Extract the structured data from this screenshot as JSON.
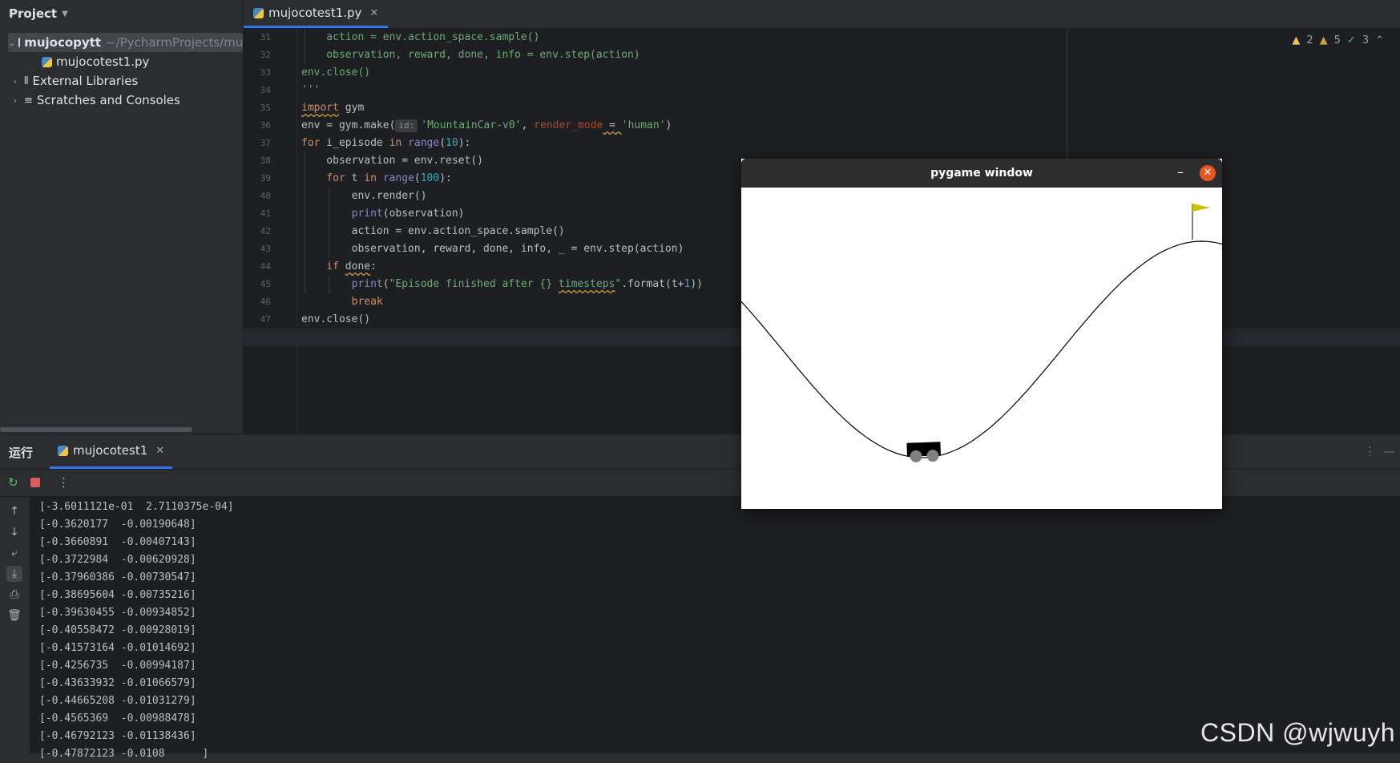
{
  "sidebar": {
    "title": "Project",
    "project_name": "mujocopytt",
    "project_path": "~/PycharmProjects/mu",
    "file": "mujocotest1.py",
    "external_libraries": "External Libraries",
    "scratches": "Scratches and Consoles"
  },
  "editor": {
    "tab_label": "mujocotest1.py",
    "inspections": {
      "warnings": "2",
      "weak_warnings": "5",
      "ok": "3"
    },
    "line_numbers": [
      "31",
      "32",
      "33",
      "34",
      "35",
      "36",
      "37",
      "38",
      "39",
      "40",
      "41",
      "42",
      "43",
      "44",
      "45",
      "46",
      "47",
      "48"
    ],
    "lines": {
      "l31": "    action = env.action_space.sample()",
      "l32": "    observation, reward, done, info = env.step(action)",
      "l33": "env.close()",
      "l34": "'''",
      "l35_kw": "import",
      "l35_rest": " gym",
      "l36_a": "env = gym.make(",
      "l36_hint": "id:",
      "l36_str": "'MountainCar-v0'",
      "l36_b": ", ",
      "l36_param": "render_mode",
      "l36_c": " = ",
      "l36_str2": "'human'",
      "l36_d": ")",
      "l37_kw": "for",
      "l37_a": " i_episode ",
      "l37_kw2": "in",
      "l37_b": " ",
      "l37_fn": "range",
      "l37_c": "(",
      "l37_num": "10",
      "l37_d": "):",
      "l38": "    observation = env.reset()",
      "l39_pre": "    ",
      "l39_kw": "for",
      "l39_a": " t ",
      "l39_kw2": "in",
      "l39_b": " ",
      "l39_fn": "range",
      "l39_c": "(",
      "l39_num": "100",
      "l39_d": "):",
      "l40": "        env.render()",
      "l41_pre": "        ",
      "l41_fn": "print",
      "l41_rest": "(observation)",
      "l42": "        action = env.action_space.sample()",
      "l43": "        observation, reward, done, info, _ = env.step(action)",
      "l44_pre": "    ",
      "l44_kw": "if",
      "l44_b": " ",
      "l44_warn": "done",
      "l44_c": ":",
      "l45_pre": "        ",
      "l45_fn": "print",
      "l45_a": "(",
      "l45_str1": "\"Episode finished after {} ",
      "l45_warn": "timesteps",
      "l45_str2": "\"",
      "l45_b": ".format(t+",
      "l45_num": "1",
      "l45_c": "))",
      "l46_pre": "        ",
      "l46_kw": "break",
      "l47": "env.close()",
      "l48": ""
    }
  },
  "run_panel": {
    "title": "运行",
    "tab_label": "mujocotest1",
    "output": [
      "[-3.6011121e-01  2.7110375e-04]",
      "[-0.3620177  -0.00190648]",
      "[-0.3660891  -0.00407143]",
      "[-0.3722984  -0.00620928]",
      "[-0.37960386 -0.00730547]",
      "[-0.38695604 -0.00735216]",
      "[-0.39630455 -0.00934852]",
      "[-0.40558472 -0.00928019]",
      "[-0.41573164 -0.01014692]",
      "[-0.4256735  -0.00994187]",
      "[-0.43633932 -0.01066579]",
      "[-0.44665208 -0.01031279]",
      "[-0.4565369  -0.00988478]",
      "[-0.46792123 -0.01138436]",
      "[-0.47872123 -0.0108      ]"
    ]
  },
  "pygame": {
    "title": "pygame window",
    "minimize_glyph": "–",
    "close_glyph": "✕",
    "flag_color": "#ccc000",
    "car_color": "#000000",
    "wheel_color": "#808080"
  },
  "watermark": "CSDN @wjwuyh"
}
